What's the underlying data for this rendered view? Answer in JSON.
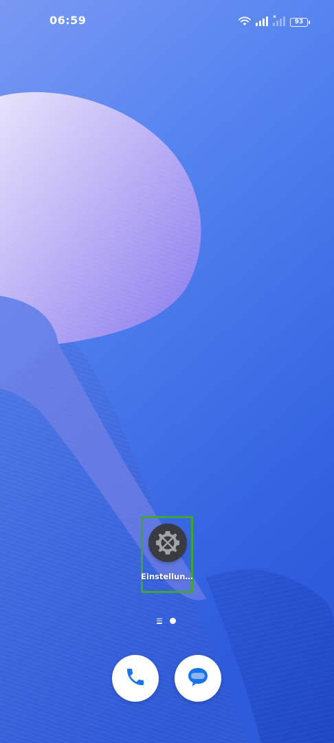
{
  "status_bar": {
    "time": "06:59",
    "battery_level": "93",
    "icons": [
      "wifi-icon",
      "signal-icon",
      "signal-no-service-icon",
      "battery-icon"
    ]
  },
  "home_screen": {
    "apps": [
      {
        "label": "Einstellun…",
        "icon": "gear-icon",
        "highlighted": true,
        "highlight_color": "#3fa535"
      }
    ],
    "page_indicator": {
      "pages": 2,
      "current": 2
    }
  },
  "dock": {
    "apps": [
      {
        "name": "phone",
        "icon": "phone-icon",
        "color": "#1a73e8"
      },
      {
        "name": "messages",
        "icon": "chat-bubble-icon",
        "color": "#1a73e8"
      }
    ]
  },
  "colors": {
    "wallpaper_blue": "#3d6de8",
    "wave_lavender": "#b6a9f2"
  }
}
